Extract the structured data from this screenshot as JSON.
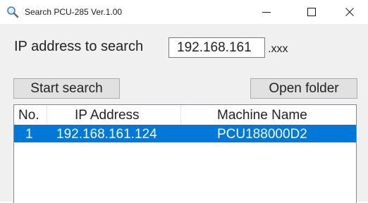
{
  "window": {
    "title": "Search PCU-285 Ver.1.00",
    "icon": "magnifier-icon",
    "controls": {
      "minimize": "minimize-icon",
      "maximize": "maximize-icon",
      "close": "close-icon"
    }
  },
  "search": {
    "label": "IP address to search",
    "ip_prefix": "192.168.161",
    "suffix": ".xxx"
  },
  "buttons": {
    "start_search": "Start search",
    "open_folder": "Open folder"
  },
  "table": {
    "headers": {
      "no": "No.",
      "ip": "IP Address",
      "machine": "Machine Name"
    },
    "rows": [
      {
        "no": "1",
        "ip": "192.168.161.124",
        "machine": "PCU188000D2",
        "selected": true
      }
    ]
  },
  "colors": {
    "selection": "#0078d7",
    "window_bg": "#f0f0f0"
  }
}
